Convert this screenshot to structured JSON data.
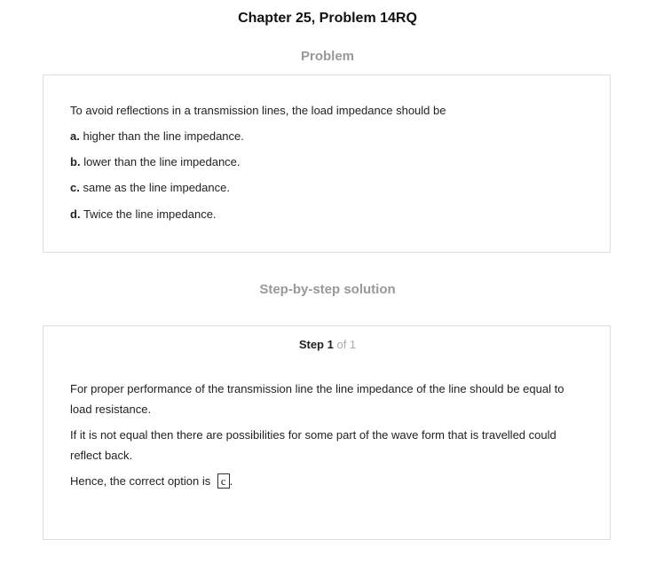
{
  "header": {
    "title": "Chapter 25, Problem 14RQ"
  },
  "problem": {
    "heading": "Problem",
    "question": "To avoid reflections in a transmission lines, the load impedance should be",
    "options": [
      {
        "letter": "a.",
        "text": "higher than the line impedance."
      },
      {
        "letter": "b.",
        "text": "lower than the line impedance."
      },
      {
        "letter": "c.",
        "text": "same as the line impedance."
      },
      {
        "letter": "d.",
        "text": "Twice the line impedance."
      }
    ]
  },
  "solution": {
    "heading": "Step-by-step solution",
    "step_label": "Step 1",
    "step_of": "of 1",
    "para1": "For proper performance of the transmission line the line impedance of the line should be equal to load resistance.",
    "para2": "If it is not equal then there are possibilities for some part of the wave form that is travelled could reflect back.",
    "para3": "Hence, the correct option is",
    "answer": "c",
    "period": "."
  }
}
